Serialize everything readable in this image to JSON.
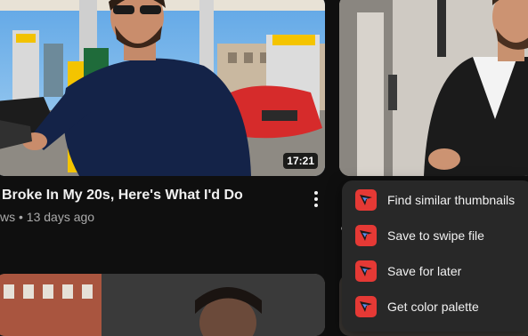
{
  "video": {
    "title": "Broke In My 20s, Here's What I'd Do",
    "meta": "ws • 13 days ago",
    "duration": "17:21"
  },
  "menu": {
    "items": [
      {
        "label": "Find similar thumbnails",
        "icon": "extension-logo-icon"
      },
      {
        "label": "Save to swipe file",
        "icon": "extension-logo-icon"
      },
      {
        "label": "Save for later",
        "icon": "extension-logo-icon"
      },
      {
        "label": "Get color palette",
        "icon": "extension-logo-icon"
      }
    ]
  },
  "colors": {
    "background": "#0f0f0f",
    "menu_bg": "#282828",
    "icon_red": "#e53935",
    "text_secondary": "#aaaaaa"
  }
}
